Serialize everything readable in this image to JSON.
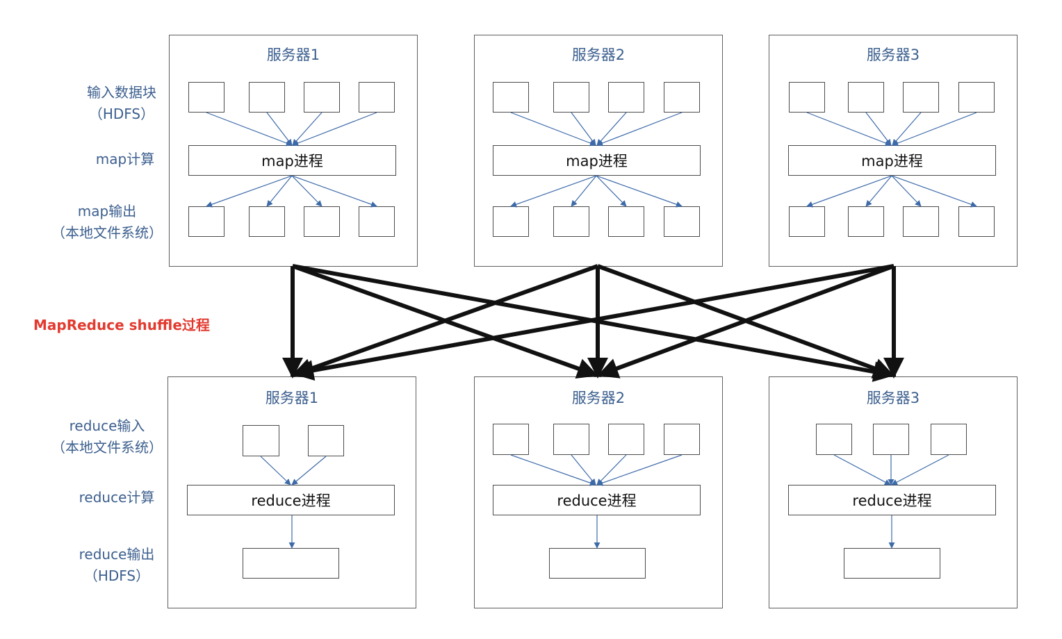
{
  "labels": {
    "input_block": "输入数据块",
    "input_block_src": "（HDFS）",
    "map_compute": "map计算",
    "map_output": "map输出",
    "map_output_src": "（本地文件系统）",
    "shuffle": "MapReduce shuffle过程",
    "reduce_input": "reduce输入",
    "reduce_input_src": "（本地文件系统）",
    "reduce_compute": "reduce计算",
    "reduce_output": "reduce输出",
    "reduce_output_src": "（HDFS）"
  },
  "map_servers": [
    {
      "title": "服务器1",
      "process": "map进程"
    },
    {
      "title": "服务器2",
      "process": "map进程"
    },
    {
      "title": "服务器3",
      "process": "map进程"
    }
  ],
  "reduce_servers": [
    {
      "title": "服务器1",
      "process": "reduce进程",
      "input_count": 2
    },
    {
      "title": "服务器2",
      "process": "reduce进程",
      "input_count": 4
    },
    {
      "title": "服务器3",
      "process": "reduce进程",
      "input_count": 3
    }
  ],
  "colors": {
    "label": "#3c5f8e",
    "shuffle": "#e23a2f",
    "thin_arrow": "#3d6aa8",
    "thick_arrow": "#111111"
  }
}
